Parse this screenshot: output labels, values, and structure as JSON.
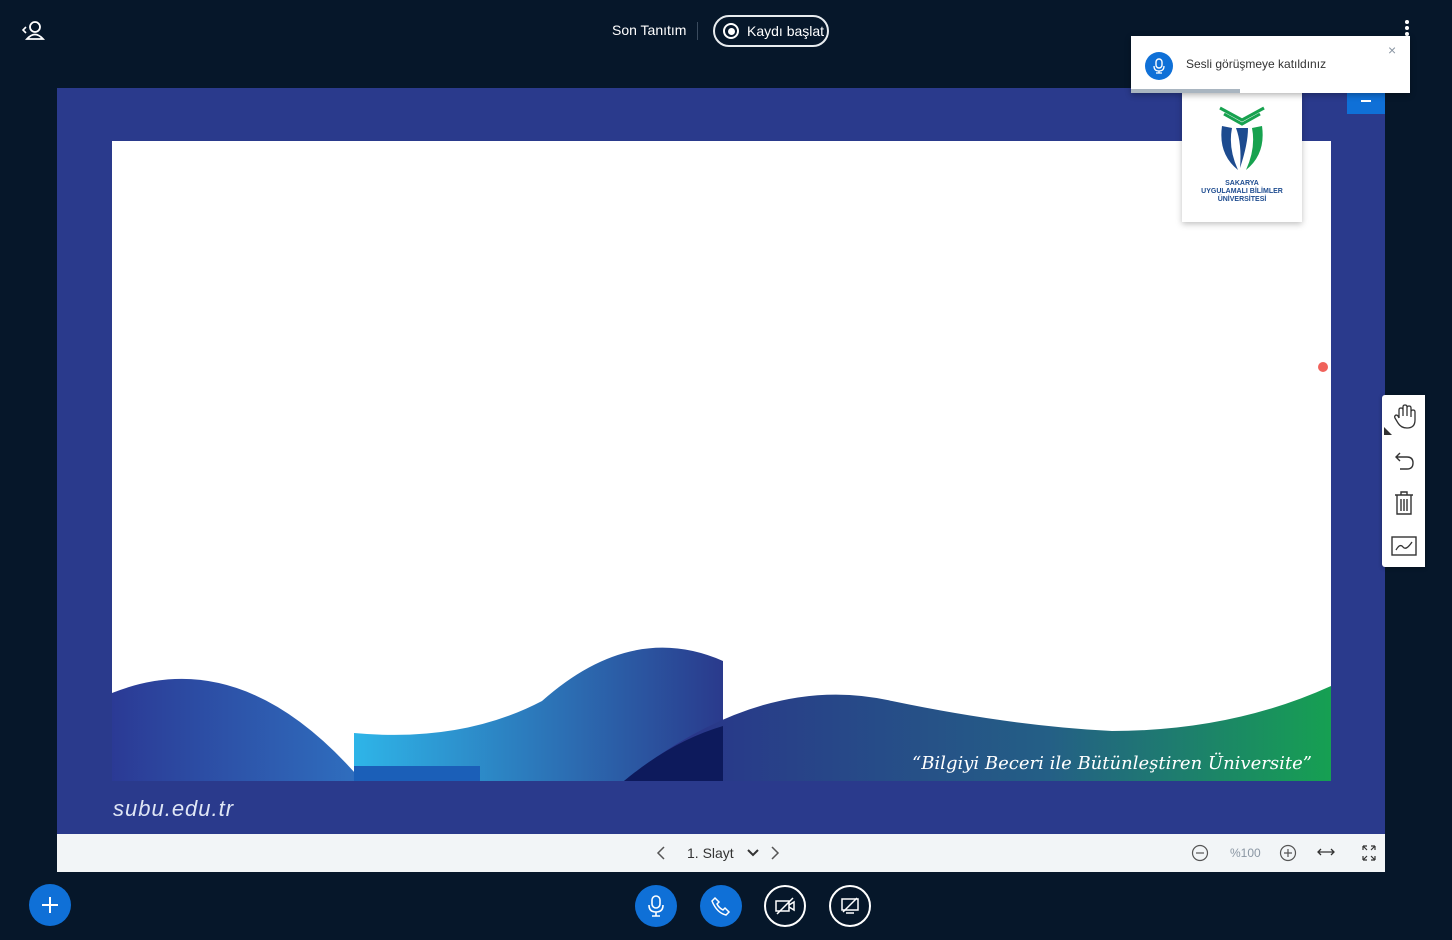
{
  "header": {
    "title": "Son Tanıtım",
    "record_label": "Kaydı başlat"
  },
  "presentation": {
    "website": "subu.edu.tr",
    "quote": "“Bilgiyi Beceri ile Bütünleştiren Üniversite”",
    "logo_lines": [
      "SAKARYA",
      "UYGULAMALI BİLİMLER",
      "ÜNİVERSİTESİ"
    ],
    "slide_select": "1. Slayt",
    "zoom": "%100"
  },
  "notification": {
    "text": "Sesli görüşmeye katıldınız",
    "close_symbol": "×",
    "progress": 0.39
  },
  "icons": {
    "user_toggle": "users-toggle-icon",
    "more": "more-options-icon",
    "hand": "hand-icon",
    "undo": "undo-icon",
    "clear": "trash-icon",
    "multi_user": "whiteboard-icon",
    "mic": "microphone-icon",
    "phone": "phone-icon",
    "video": "video-off-icon",
    "screen": "screenshare-off-icon"
  },
  "colors": {
    "background": "#06172a",
    "slide_frame": "#2a3a8c",
    "accent": "#0f70d7",
    "recording_dot": "#f0625b"
  }
}
